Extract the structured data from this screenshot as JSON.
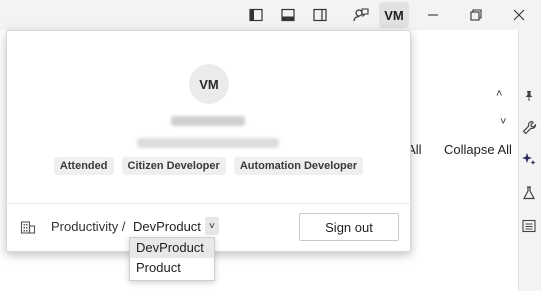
{
  "titlebar": {
    "icons": [
      "sidebar-left-icon",
      "panel-bottom-icon",
      "sidebar-right-icon",
      "person-feedback-icon"
    ],
    "avatar_initials": "VM",
    "window_controls": [
      "minimize-icon",
      "restore-icon",
      "close-icon"
    ]
  },
  "background": {
    "expand_all_partial": "d All",
    "collapse_all": "Collapse All"
  },
  "rail": {
    "icons": [
      "pin-icon",
      "wrench-icon",
      "sparkle-icon",
      "flask-icon",
      "list-icon"
    ]
  },
  "account": {
    "avatar_initials": "VM",
    "roles": [
      "Attended",
      "Citizen Developer",
      "Automation Developer"
    ],
    "org_prefix": "Productivity /",
    "selected_tenant": "DevProduct",
    "sign_out_label": "Sign out"
  },
  "tenant_dropdown": {
    "options": [
      "DevProduct",
      "Product"
    ],
    "selected_index": 0
  },
  "colors": {
    "popup_bg": "#ffffff",
    "chrome_bg": "#f3f3f3",
    "badge_bg": "#efefef",
    "selected_option_bg": "#e8e8e8"
  }
}
